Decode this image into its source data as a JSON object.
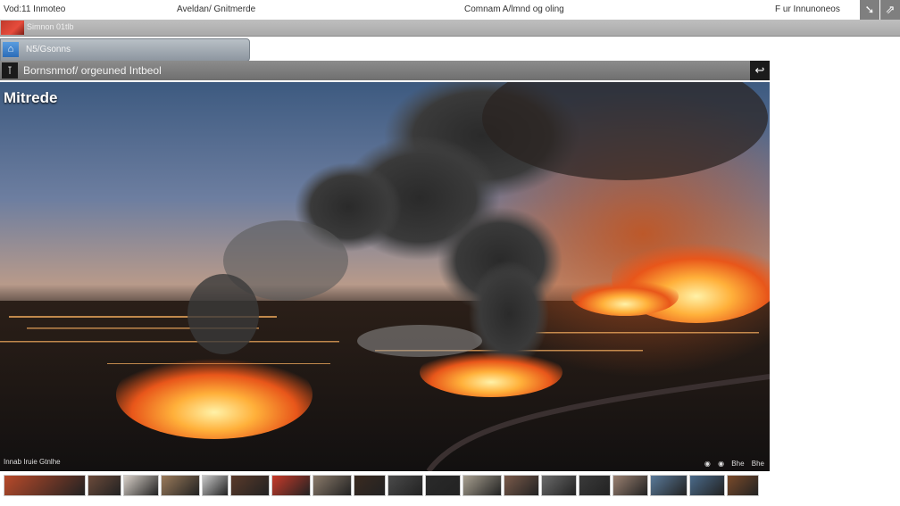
{
  "topnav": {
    "links": [
      "Vod:11 Inmoteo",
      "Aveldan/ Gnitmerde",
      "Comnam A/lmnd og oling",
      "F ur Innunoneos"
    ],
    "corner_icons": [
      "arrow-icon",
      "share-icon"
    ]
  },
  "graybar": {
    "label": "Simnon 01tlb"
  },
  "subtab": {
    "label": "N5/Gsonns",
    "icon_glyph": "⌂"
  },
  "viewer": {
    "title": "Bornsnmof/ orgeuned Intbeol",
    "caption": "Mitrede",
    "credit": "Innab  Iruie  Gtnlhe",
    "controls": [
      "◉",
      "◉",
      "Bhe",
      "Bhe"
    ]
  },
  "thumbnails": {
    "colors": [
      "#b84a2a",
      "#6b4a3a",
      "#d8d0c8",
      "#9a7a5a",
      "#c8c8c8",
      "#5a3a2a",
      "#c83a2a",
      "#8a7a6a",
      "#3a2a20",
      "#4a4a4a",
      "#2a2a2a",
      "#a8a090",
      "#7a5a4a",
      "#6a6a6a",
      "#3a3a3a",
      "#9a8070",
      "#5a7a9a",
      "#4a6a8a",
      "#7a4a2a"
    ],
    "widths": [
      92,
      38,
      40,
      44,
      30,
      44,
      44,
      44,
      36,
      40,
      40,
      44,
      40,
      40,
      36,
      40,
      42,
      40,
      36
    ]
  },
  "colors": {
    "bar": "#8c8c8c",
    "accent": "#c0392b"
  }
}
